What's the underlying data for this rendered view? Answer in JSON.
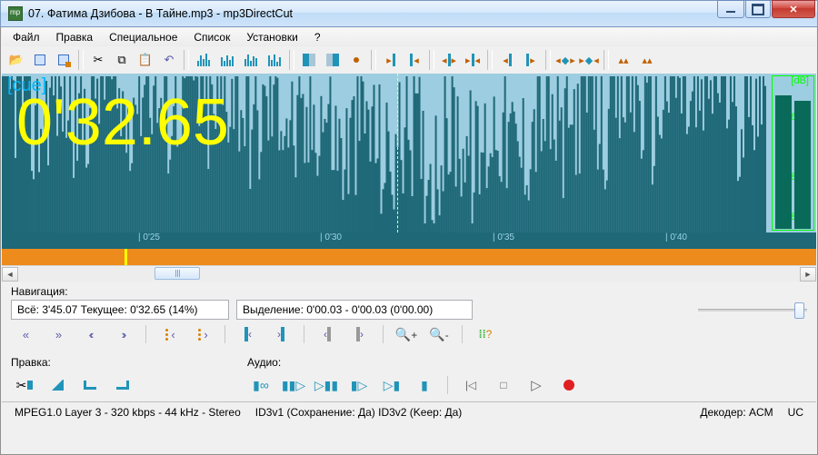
{
  "window": {
    "title": "07. Фатима Дзибова - В Тайне.mp3 - mp3DirectCut"
  },
  "menu": {
    "file": "Файл",
    "edit": "Правка",
    "special": "Специальное",
    "list": "Список",
    "settings": "Установки",
    "help": "?"
  },
  "waveform": {
    "cue_label": "[cue]",
    "big_time": "0'32.65",
    "db_label": "[dB]",
    "db_scale": {
      "m6": "-6",
      "m18": "-18",
      "m48": "-48"
    }
  },
  "ruler": {
    "t1": "| 0'25",
    "t2": "| 0'30",
    "t3": "| 0'35",
    "t4": "| 0'40"
  },
  "nav": {
    "label": "Навигация:",
    "all_current": "Всё: 3'45.07   Текущее: 0'32.65   (14%)",
    "selection": "Выделение:  0'00.03 - 0'00.03 (0'00.00)"
  },
  "edit": {
    "label": "Правка:"
  },
  "audio": {
    "label": "Аудио:"
  },
  "status": {
    "format": "MPEG1.0 Layer 3 - 320 kbps - 44 kHz - Stereo",
    "id3": "ID3v1 (Сохранение: Да)   ID3v2 (Keep: Да)",
    "decoder": "Декодер: ACM",
    "uc": "UC"
  },
  "icons": {
    "open": "📂",
    "save1": "💾",
    "save2": "💾",
    "cut": "✂",
    "copy": "⧉",
    "paste": "📋",
    "undo": "↶",
    "first": "«",
    "prev": "‹",
    "next": "›",
    "last": "»",
    "zoomin": "🔍+",
    "zoomout": "🔍-",
    "play": "▷",
    "stop": "□",
    "pause": "||",
    "rewind": "|◁",
    "record": "●"
  }
}
